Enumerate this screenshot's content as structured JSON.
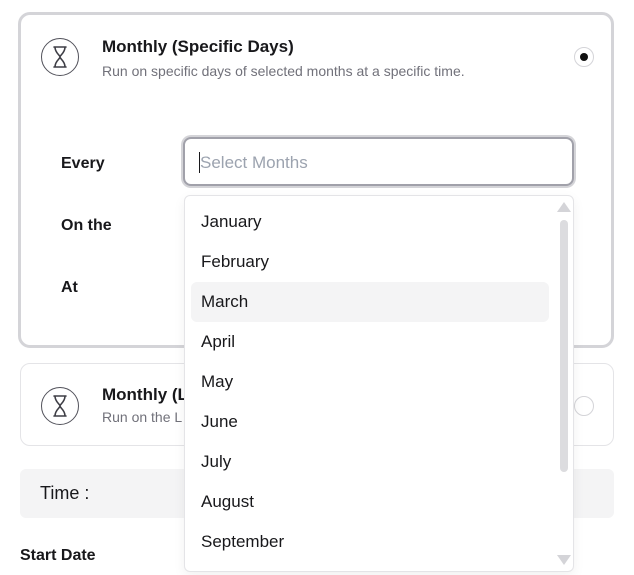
{
  "option_selected": {
    "title": "Monthly (Specific Days)",
    "description": "Run on specific days of selected months at a specific time.",
    "icon": "hourglass-icon",
    "selected": true
  },
  "form": {
    "every_label": "Every",
    "on_the_label": "On the",
    "at_label": "At",
    "months_placeholder": "Select Months"
  },
  "option_last": {
    "title_visible": "Monthly (L",
    "description_visible": "Run on the L",
    "icon": "hourglass-icon",
    "selected": false
  },
  "time_label": "Time :",
  "start_date_label": "Start Date",
  "months_dropdown": {
    "options": [
      "January",
      "February",
      "March",
      "April",
      "May",
      "June",
      "July",
      "August",
      "September"
    ],
    "highlighted": "March"
  },
  "colors": {
    "selected_border": "#d4d4d8",
    "highlight_bg": "#f4f4f5",
    "text": "#18181b",
    "muted_text": "#71717a"
  }
}
